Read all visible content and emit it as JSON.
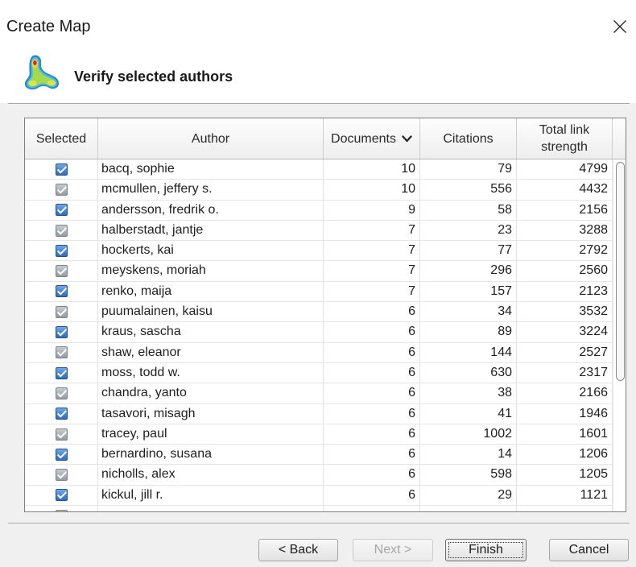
{
  "window": {
    "title": "Create Map",
    "close_icon": "close-icon"
  },
  "header": {
    "icon": "density-map-icon",
    "title": "Verify selected authors"
  },
  "table": {
    "columns": {
      "selected": "Selected",
      "author": "Author",
      "documents": "Documents",
      "citations": "Citations",
      "total_link_strength": "Total link strength"
    },
    "sort_icon": "chevron-down-icon",
    "rows": [
      {
        "selected": true,
        "author": "bacq, sophie",
        "documents": 10,
        "citations": 79,
        "total_link_strength": 4799
      },
      {
        "selected": true,
        "author": "mcmullen, jeffery s.",
        "documents": 10,
        "citations": 556,
        "total_link_strength": 4432
      },
      {
        "selected": true,
        "author": "andersson, fredrik o.",
        "documents": 9,
        "citations": 58,
        "total_link_strength": 2156
      },
      {
        "selected": true,
        "author": "halberstadt, jantje",
        "documents": 7,
        "citations": 23,
        "total_link_strength": 3288
      },
      {
        "selected": true,
        "author": "hockerts, kai",
        "documents": 7,
        "citations": 77,
        "total_link_strength": 2792
      },
      {
        "selected": true,
        "author": "meyskens, moriah",
        "documents": 7,
        "citations": 296,
        "total_link_strength": 2560
      },
      {
        "selected": true,
        "author": "renko, maija",
        "documents": 7,
        "citations": 157,
        "total_link_strength": 2123
      },
      {
        "selected": true,
        "author": "puumalainen, kaisu",
        "documents": 6,
        "citations": 34,
        "total_link_strength": 3532
      },
      {
        "selected": true,
        "author": "kraus, sascha",
        "documents": 6,
        "citations": 89,
        "total_link_strength": 3224
      },
      {
        "selected": true,
        "author": "shaw, eleanor",
        "documents": 6,
        "citations": 144,
        "total_link_strength": 2527
      },
      {
        "selected": true,
        "author": "moss, todd w.",
        "documents": 6,
        "citations": 630,
        "total_link_strength": 2317
      },
      {
        "selected": true,
        "author": "chandra, yanto",
        "documents": 6,
        "citations": 38,
        "total_link_strength": 2166
      },
      {
        "selected": true,
        "author": "tasavori, misagh",
        "documents": 6,
        "citations": 41,
        "total_link_strength": 1946
      },
      {
        "selected": true,
        "author": "tracey, paul",
        "documents": 6,
        "citations": 1002,
        "total_link_strength": 1601
      },
      {
        "selected": true,
        "author": "bernardino, susana",
        "documents": 6,
        "citations": 14,
        "total_link_strength": 1206
      },
      {
        "selected": true,
        "author": "nicholls, alex",
        "documents": 6,
        "citations": 598,
        "total_link_strength": 1205
      },
      {
        "selected": true,
        "author": "kickul, jill r.",
        "documents": 6,
        "citations": 29,
        "total_link_strength": 1121
      },
      {
        "selected": true
      }
    ]
  },
  "buttons": {
    "back": {
      "label": "< Back",
      "enabled": true
    },
    "next": {
      "label": "Next >",
      "enabled": false
    },
    "finish": {
      "label": "Finish",
      "enabled": true,
      "focused": true
    },
    "cancel": {
      "label": "Cancel",
      "enabled": true
    }
  }
}
